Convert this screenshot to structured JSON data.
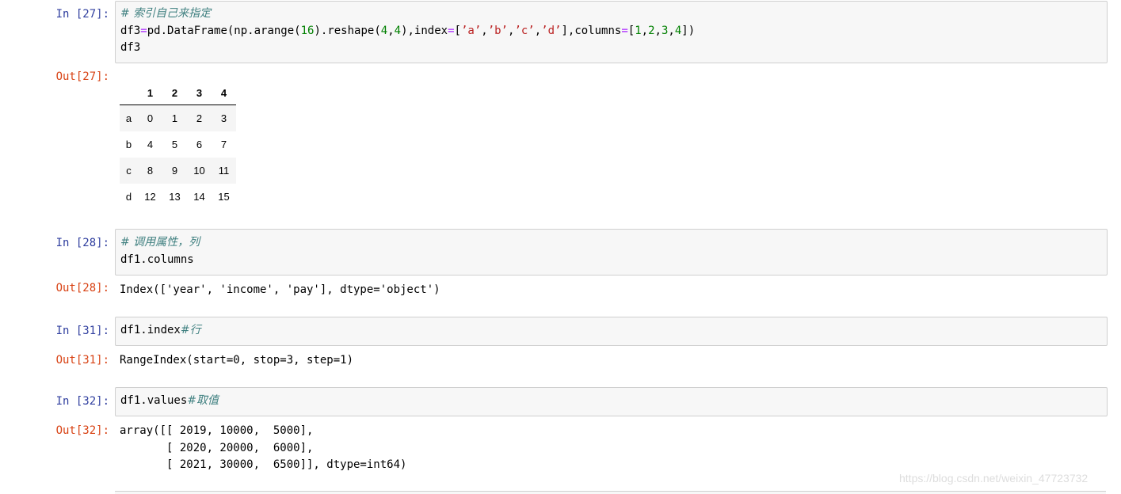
{
  "cells": [
    {
      "in_prompt": "In  [27]:",
      "code_lines": [
        [
          {
            "t": "# 索引自己来指定",
            "c": "cmt"
          }
        ],
        [
          {
            "t": "df3"
          },
          {
            "t": "=",
            "c": "op"
          },
          {
            "t": "pd.DataFrame(np.arange("
          },
          {
            "t": "16",
            "c": "num"
          },
          {
            "t": ").reshape("
          },
          {
            "t": "4",
            "c": "num"
          },
          {
            "t": ","
          },
          {
            "t": "4",
            "c": "num"
          },
          {
            "t": "),index"
          },
          {
            "t": "=",
            "c": "op"
          },
          {
            "t": "["
          },
          {
            "t": "’a’",
            "c": "str"
          },
          {
            "t": ","
          },
          {
            "t": "’b’",
            "c": "str"
          },
          {
            "t": ","
          },
          {
            "t": "’c’",
            "c": "str"
          },
          {
            "t": ","
          },
          {
            "t": "’d’",
            "c": "str"
          },
          {
            "t": "],columns"
          },
          {
            "t": "=",
            "c": "op"
          },
          {
            "t": "["
          },
          {
            "t": "1",
            "c": "num"
          },
          {
            "t": ","
          },
          {
            "t": "2",
            "c": "num"
          },
          {
            "t": ","
          },
          {
            "t": "3",
            "c": "num"
          },
          {
            "t": ","
          },
          {
            "t": "4",
            "c": "num"
          },
          {
            "t": "])"
          }
        ],
        [
          {
            "t": "df3"
          }
        ]
      ],
      "out_prompt": "Out[27]:",
      "output_table": {
        "columns": [
          "",
          "1",
          "2",
          "3",
          "4"
        ],
        "rows": [
          [
            "a",
            "0",
            "1",
            "2",
            "3"
          ],
          [
            "b",
            "4",
            "5",
            "6",
            "7"
          ],
          [
            "c",
            "8",
            "9",
            "10",
            "11"
          ],
          [
            "d",
            "12",
            "13",
            "14",
            "15"
          ]
        ]
      }
    },
    {
      "in_prompt": "In  [28]:",
      "code_lines": [
        [
          {
            "t": "# 调用属性，列",
            "c": "cmt"
          }
        ],
        [
          {
            "t": "df1.columns"
          }
        ]
      ],
      "out_prompt": "Out[28]:",
      "output_text": "Index(['year', 'income', 'pay'], dtype='object')"
    },
    {
      "in_prompt": "In  [31]:",
      "code_lines": [
        [
          {
            "t": "df1.index"
          },
          {
            "t": "#行",
            "c": "cmt"
          }
        ]
      ],
      "out_prompt": "Out[31]:",
      "output_text": "RangeIndex(start=0, stop=3, step=1)"
    },
    {
      "in_prompt": "In  [32]:",
      "code_lines": [
        [
          {
            "t": "df1.values"
          },
          {
            "t": "#取值",
            "c": "cmt"
          }
        ]
      ],
      "out_prompt": "Out[32]:",
      "output_text": "array([[ 2019, 10000,  5000],\n       [ 2020, 20000,  6000],\n       [ 2021, 30000,  6500]], dtype=int64)"
    }
  ],
  "watermark": "https://blog.csdn.net/weixin_47723732"
}
